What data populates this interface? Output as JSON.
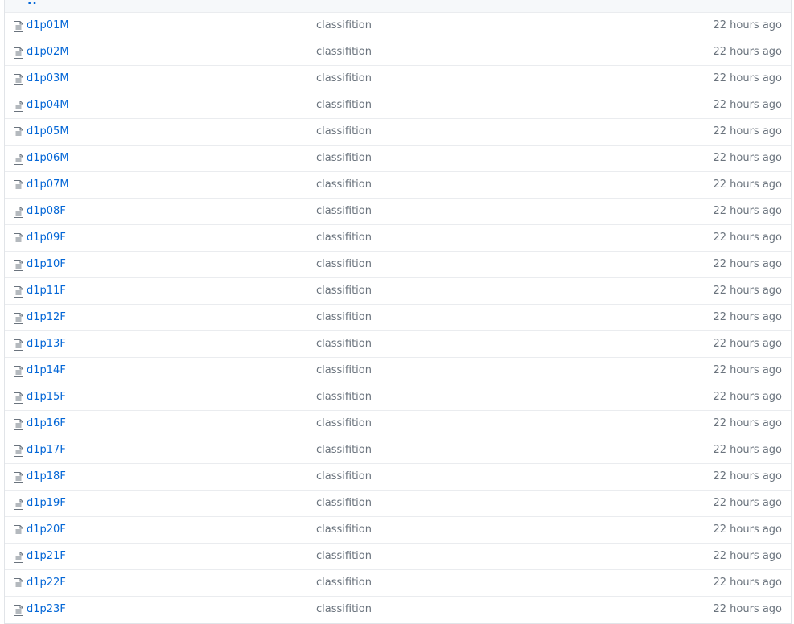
{
  "parent_dir_label": "..",
  "colors": {
    "link": "#0366d6",
    "muted": "#6a737d",
    "border": "#eaecef",
    "header_bg": "#f6f8fa"
  },
  "rows": [
    {
      "icon": "file-icon",
      "name": "d1p01M",
      "message": "classifition",
      "age": "22 hours ago"
    },
    {
      "icon": "file-icon",
      "name": "d1p02M",
      "message": "classifition",
      "age": "22 hours ago"
    },
    {
      "icon": "file-icon",
      "name": "d1p03M",
      "message": "classifition",
      "age": "22 hours ago"
    },
    {
      "icon": "file-icon",
      "name": "d1p04M",
      "message": "classifition",
      "age": "22 hours ago"
    },
    {
      "icon": "file-icon",
      "name": "d1p05M",
      "message": "classifition",
      "age": "22 hours ago"
    },
    {
      "icon": "file-icon",
      "name": "d1p06M",
      "message": "classifition",
      "age": "22 hours ago"
    },
    {
      "icon": "file-icon",
      "name": "d1p07M",
      "message": "classifition",
      "age": "22 hours ago"
    },
    {
      "icon": "file-icon",
      "name": "d1p08F",
      "message": "classifition",
      "age": "22 hours ago"
    },
    {
      "icon": "file-icon",
      "name": "d1p09F",
      "message": "classifition",
      "age": "22 hours ago"
    },
    {
      "icon": "file-icon",
      "name": "d1p10F",
      "message": "classifition",
      "age": "22 hours ago"
    },
    {
      "icon": "file-icon",
      "name": "d1p11F",
      "message": "classifition",
      "age": "22 hours ago"
    },
    {
      "icon": "file-icon",
      "name": "d1p12F",
      "message": "classifition",
      "age": "22 hours ago"
    },
    {
      "icon": "file-icon",
      "name": "d1p13F",
      "message": "classifition",
      "age": "22 hours ago"
    },
    {
      "icon": "file-icon",
      "name": "d1p14F",
      "message": "classifition",
      "age": "22 hours ago"
    },
    {
      "icon": "file-icon",
      "name": "d1p15F",
      "message": "classifition",
      "age": "22 hours ago"
    },
    {
      "icon": "file-icon",
      "name": "d1p16F",
      "message": "classifition",
      "age": "22 hours ago"
    },
    {
      "icon": "file-icon",
      "name": "d1p17F",
      "message": "classifition",
      "age": "22 hours ago"
    },
    {
      "icon": "file-icon",
      "name": "d1p18F",
      "message": "classifition",
      "age": "22 hours ago"
    },
    {
      "icon": "file-icon",
      "name": "d1p19F",
      "message": "classifition",
      "age": "22 hours ago"
    },
    {
      "icon": "file-icon",
      "name": "d1p20F",
      "message": "classifition",
      "age": "22 hours ago"
    },
    {
      "icon": "file-icon",
      "name": "d1p21F",
      "message": "classifition",
      "age": "22 hours ago"
    },
    {
      "icon": "file-icon",
      "name": "d1p22F",
      "message": "classifition",
      "age": "22 hours ago"
    },
    {
      "icon": "file-icon",
      "name": "d1p23F",
      "message": "classifition",
      "age": "22 hours ago"
    }
  ]
}
